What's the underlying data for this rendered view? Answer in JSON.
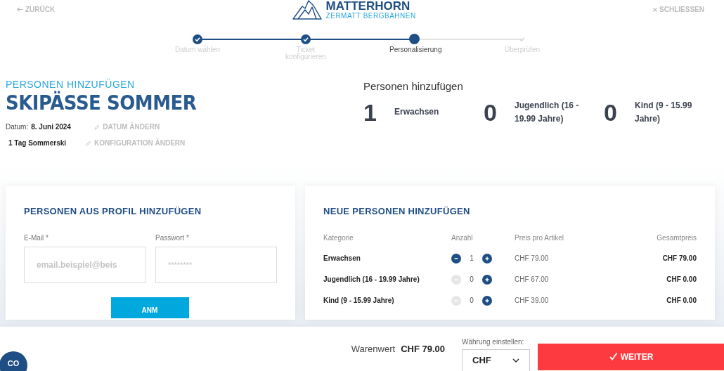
{
  "header": {
    "back": "ZURÜCK",
    "logo_title": "MATTERHORN",
    "logo_subtitle": "ZERMATT BERGBAHNEN",
    "close": "SCHLIESSEN"
  },
  "steps": [
    {
      "label": "Datum wählen",
      "completed": true,
      "selected": false
    },
    {
      "label": "Ticket konfigurieren",
      "completed": true,
      "selected": false
    },
    {
      "label": "Personalisierung",
      "completed": false,
      "selected": true
    },
    {
      "label": "Überprüfen",
      "completed": false,
      "selected": false
    }
  ],
  "intro": {
    "eyebrow": "PERSONEN HINZUFÜGEN",
    "title": "SKIPÄSSE SOMMER",
    "date_label": "Datum:",
    "date": "8. Juni 2024",
    "change_date": "DATUM ÄNDERN",
    "product": "1 Tag Sommerski",
    "change_config": "KONFIGURATION ÄNDERN"
  },
  "summary": {
    "title": "Personen hinzufügen",
    "items": [
      {
        "count": "1",
        "label": "Erwachsen"
      },
      {
        "count": "0",
        "label": "Jugendlich (16 - 19.99 Jahre)"
      },
      {
        "count": "0",
        "label": "Kind (9 - 15.99 Jahre)"
      }
    ]
  },
  "profile": {
    "title": "PERSONEN AUS PROFIL HINZUFÜGEN",
    "email_label": "E-Mail *",
    "email_placeholder": "email.beispiel@beis",
    "password_label": "Passwort *",
    "password_placeholder": "********",
    "login": "ANM"
  },
  "new_persons": {
    "title": "NEUE PERSONEN HINZUFÜGEN",
    "columns": [
      "Kategorie",
      "Anzahl",
      "Preis pro Artikel",
      "Gesamtpreis"
    ],
    "rows": [
      {
        "category": "Erwachsen",
        "quantity": "1",
        "minus_disabled": false,
        "unit_price": "CHF 79.00",
        "total": "CHF 79.00"
      },
      {
        "category": "Jugendlich (16 - 19.99 Jahre)",
        "quantity": "0",
        "minus_disabled": true,
        "unit_price": "CHF 67.00",
        "total": "CHF 0.00"
      },
      {
        "category": "Kind (9 - 15.99 Jahre)",
        "quantity": "0",
        "minus_disabled": true,
        "unit_price": "CHF 39.00",
        "total": "CHF 0.00"
      }
    ]
  },
  "footer": {
    "chat": "CO",
    "goods_label": "Warenwert",
    "goods_value": "CHF 79.00",
    "currency_label": "Währung einstellen:",
    "currency": "CHF",
    "next": "WEITER"
  }
}
